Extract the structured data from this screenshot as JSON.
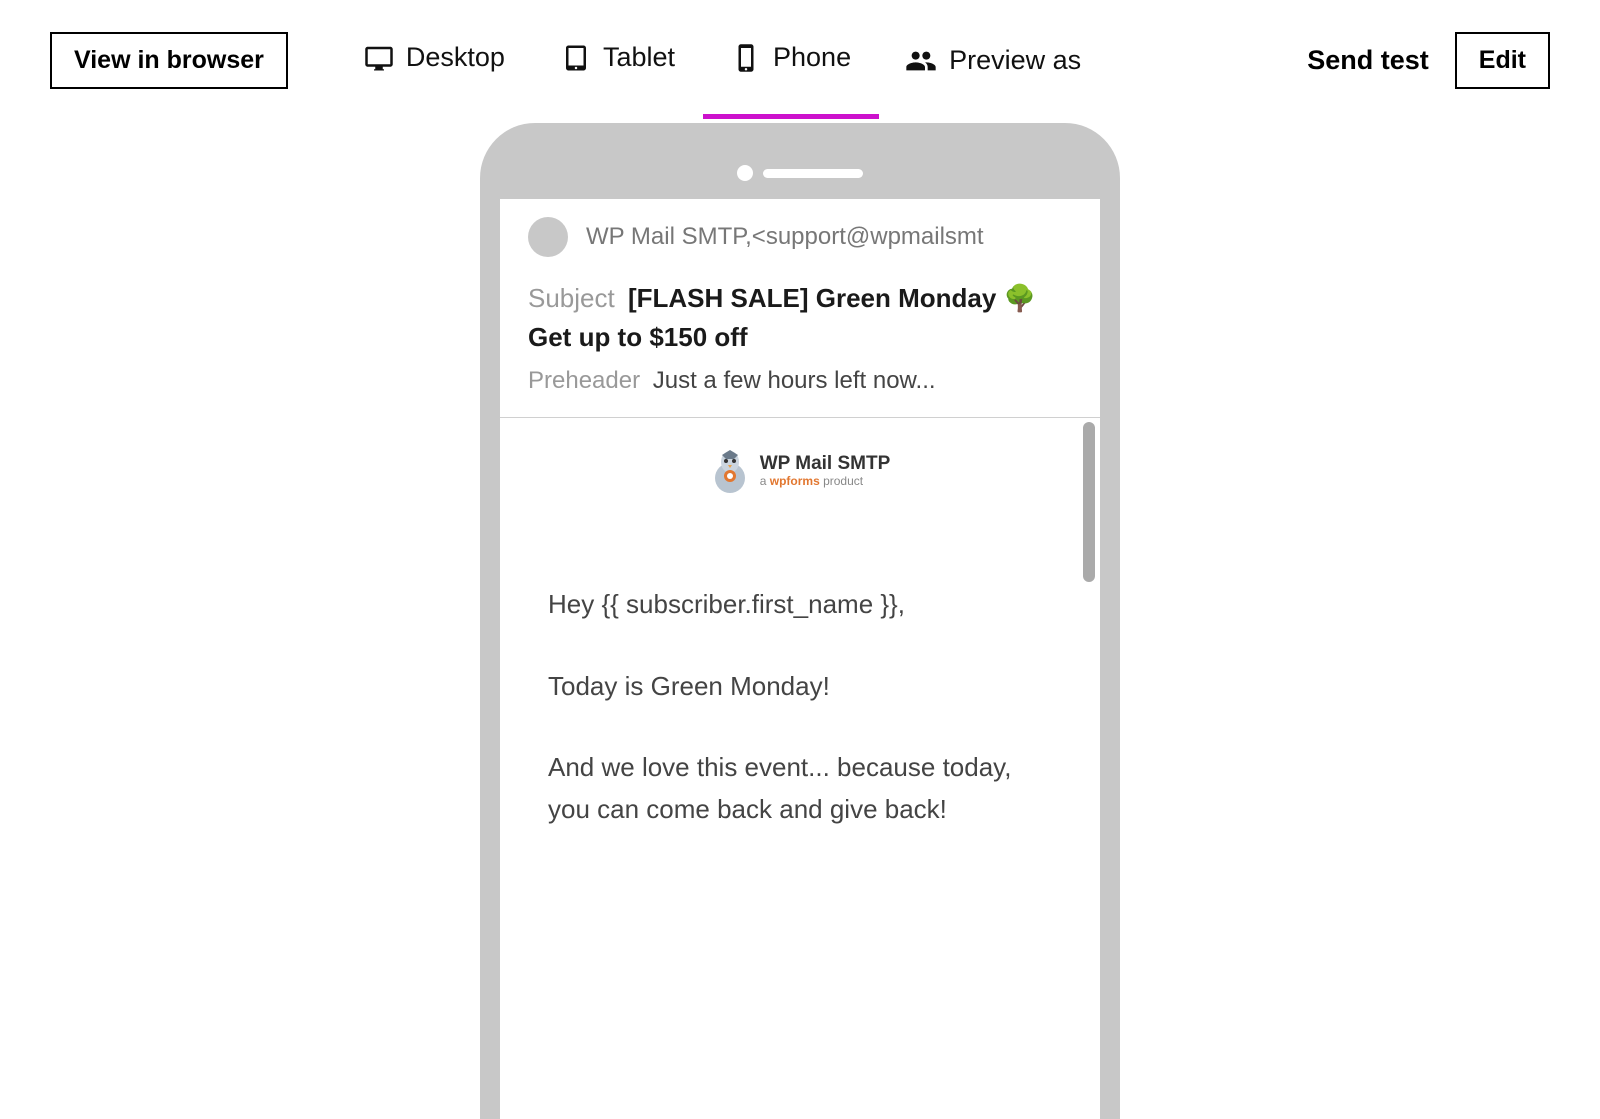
{
  "toolbar": {
    "view_in_browser": "View in browser",
    "desktop": "Desktop",
    "tablet": "Tablet",
    "phone": "Phone",
    "preview_as": "Preview as",
    "send_test": "Send test",
    "edit": "Edit"
  },
  "email": {
    "sender": "WP Mail SMTP,<support@wpmailsmt",
    "subject_label": "Subject",
    "subject": "[FLASH SALE] Green Monday 🌳 Get up to $150 off",
    "preheader_label": "Preheader",
    "preheader": "Just a few hours left now...",
    "logo_title": "WP Mail SMTP",
    "logo_sub_prefix": "a ",
    "logo_sub_brand": "wpforms",
    "logo_sub_suffix": " product",
    "body": {
      "p1": "Hey {{ subscriber.first_name }},",
      "p2": "Today is Green Monday!",
      "p3": "And we love this event... because today, you can come back and give back!"
    }
  }
}
